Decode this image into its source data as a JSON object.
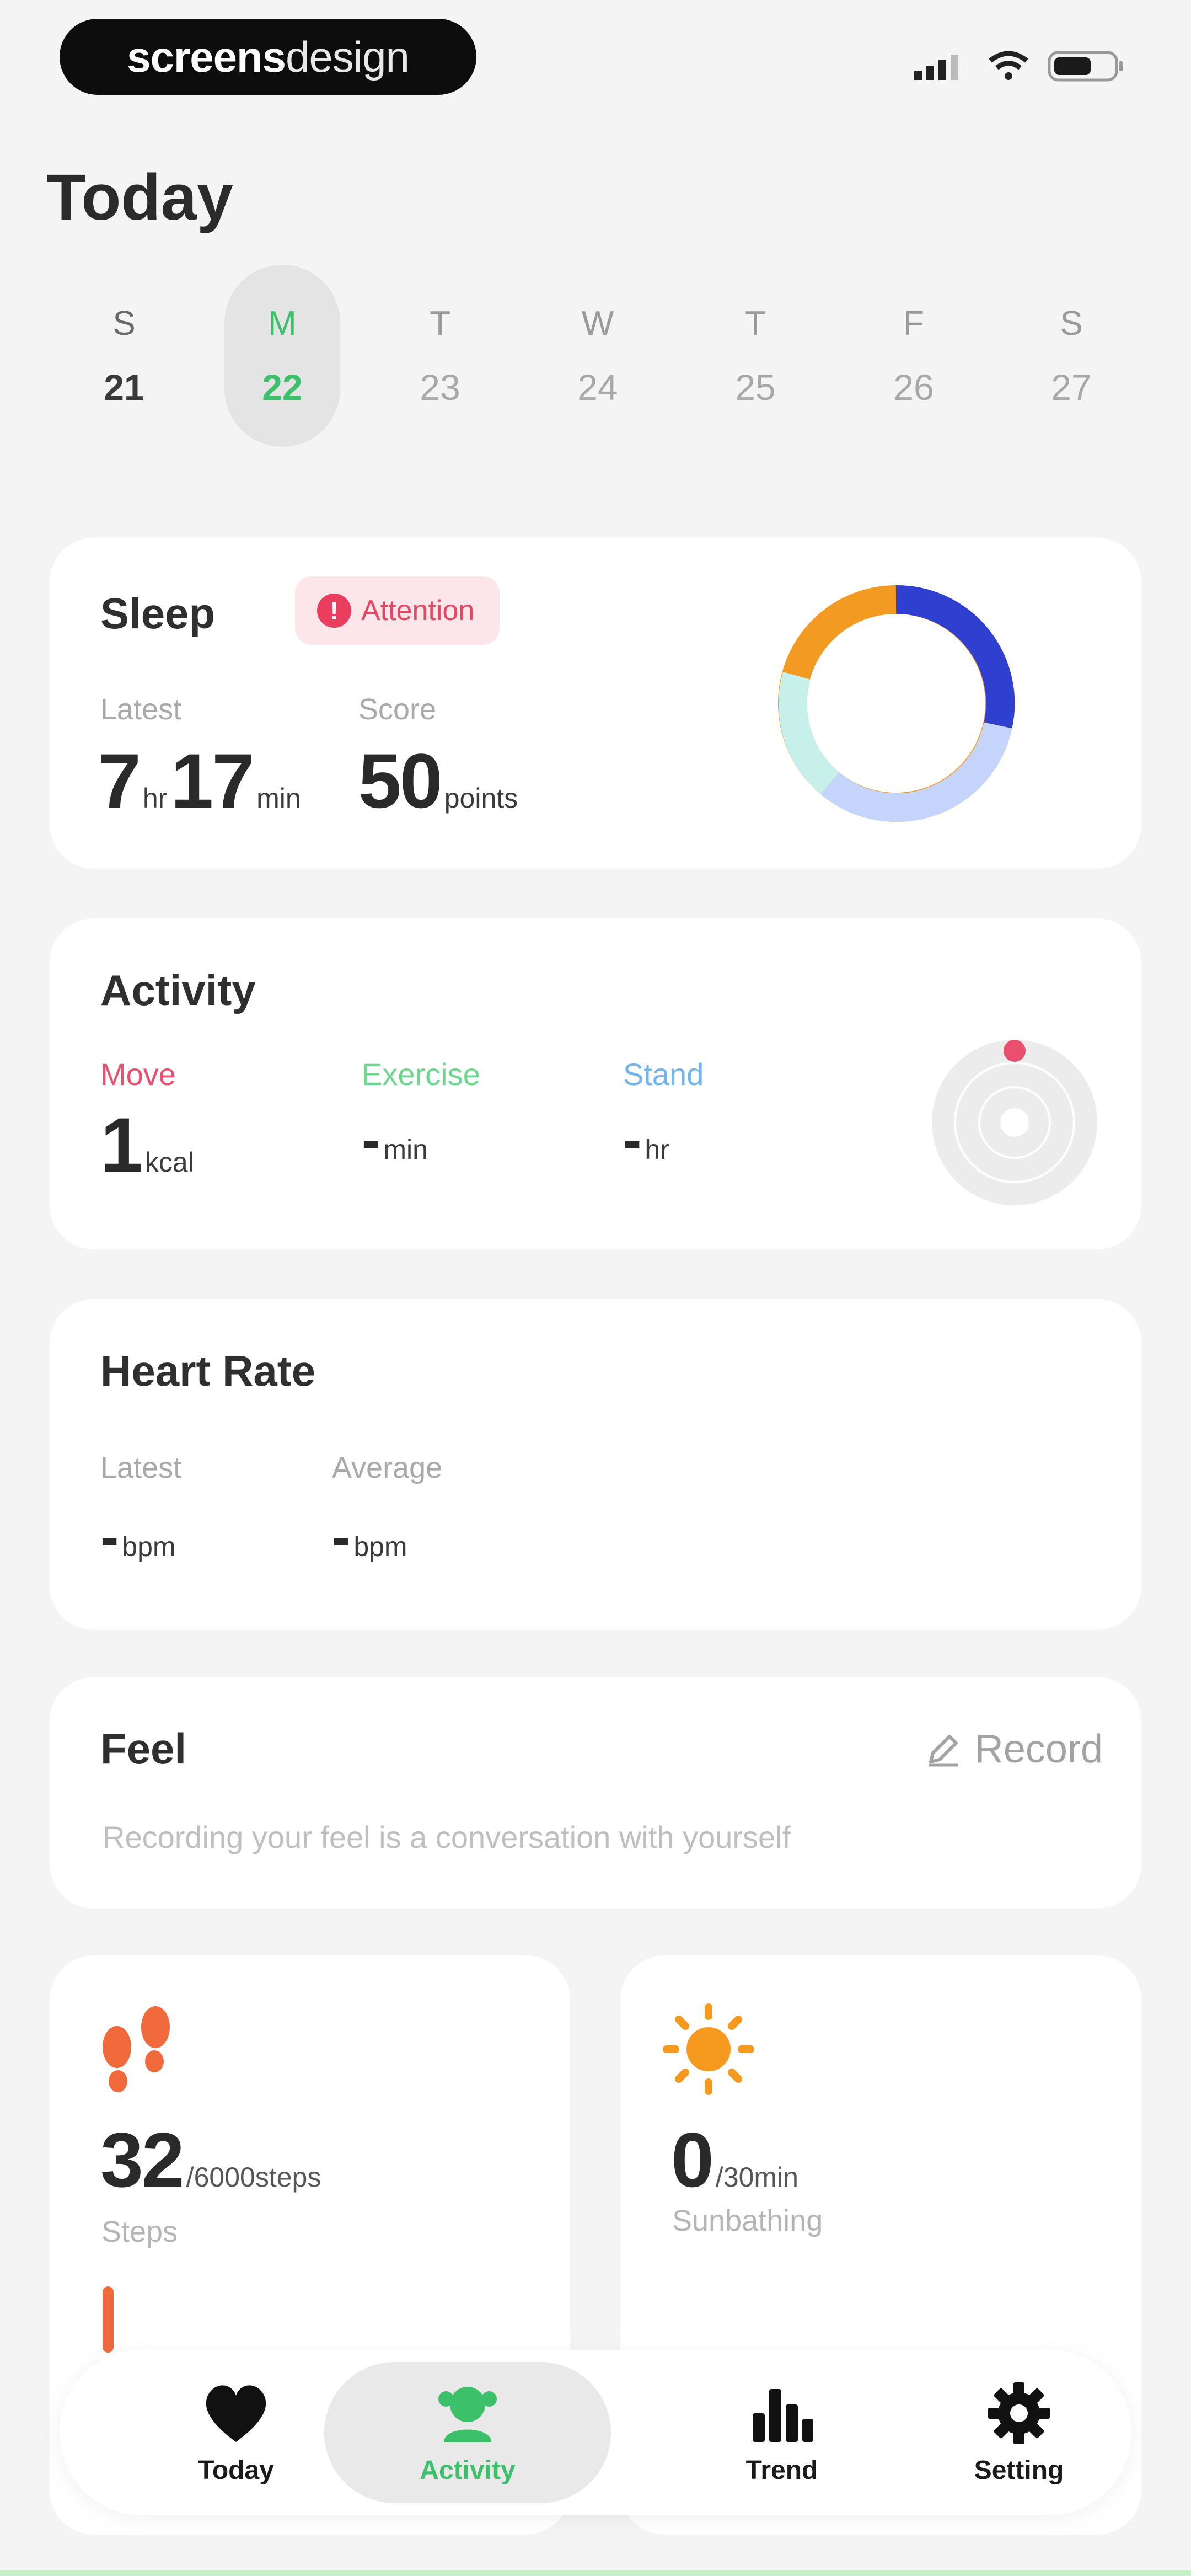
{
  "status_bar": {
    "brand_a": "screens",
    "brand_b": "design"
  },
  "page": {
    "title": "Today"
  },
  "week": [
    {
      "letter": "S",
      "date": "21",
      "state": "normal"
    },
    {
      "letter": "M",
      "date": "22",
      "state": "active"
    },
    {
      "letter": "T",
      "date": "23",
      "state": "muted"
    },
    {
      "letter": "W",
      "date": "24",
      "state": "muted"
    },
    {
      "letter": "T",
      "date": "25",
      "state": "muted"
    },
    {
      "letter": "F",
      "date": "26",
      "state": "muted"
    },
    {
      "letter": "S",
      "date": "27",
      "state": "muted"
    }
  ],
  "sleep": {
    "title": "Sleep",
    "badge": "Attention",
    "latest_label": "Latest",
    "hours": "7",
    "hours_unit": "hr",
    "minutes": "17",
    "minutes_unit": "min",
    "score_label": "Score",
    "score": "50",
    "score_unit": "points",
    "ring_colors": [
      "#2f3fcf",
      "#c4d4fb",
      "#c8f0ea",
      "#f29a22"
    ]
  },
  "activity": {
    "title": "Activity",
    "move_label": "Move",
    "move_value": "1",
    "move_unit": "kcal",
    "move_color": "#e9506e",
    "exercise_label": "Exercise",
    "exercise_value": "-",
    "exercise_unit": "min",
    "exercise_color": "#6cd88e",
    "stand_label": "Stand",
    "stand_value": "-",
    "stand_unit": "hr",
    "stand_color": "#72b4ee"
  },
  "heart_rate": {
    "title": "Heart Rate",
    "latest_label": "Latest",
    "latest_value": "-",
    "latest_unit": "bpm",
    "average_label": "Average",
    "average_value": "-",
    "average_unit": "bpm"
  },
  "feel": {
    "title": "Feel",
    "record_label": "Record",
    "hint": "Recording your feel is a conversation with yourself"
  },
  "steps": {
    "value": "32",
    "goal": "/6000steps",
    "label": "Steps",
    "icon": "footprints-icon",
    "color": "#f06a3c"
  },
  "sun": {
    "value": "0",
    "goal": "/30min",
    "label": "Sunbathing",
    "icon": "sun-icon",
    "color": "#f59a1e"
  },
  "nav": [
    {
      "label": "Today",
      "icon": "heart-icon",
      "active": false
    },
    {
      "label": "Activity",
      "icon": "activity-icon",
      "active": true
    },
    {
      "label": "Trend",
      "icon": "bar-chart-icon",
      "active": false
    },
    {
      "label": "Setting",
      "icon": "gear-icon",
      "active": false
    }
  ]
}
